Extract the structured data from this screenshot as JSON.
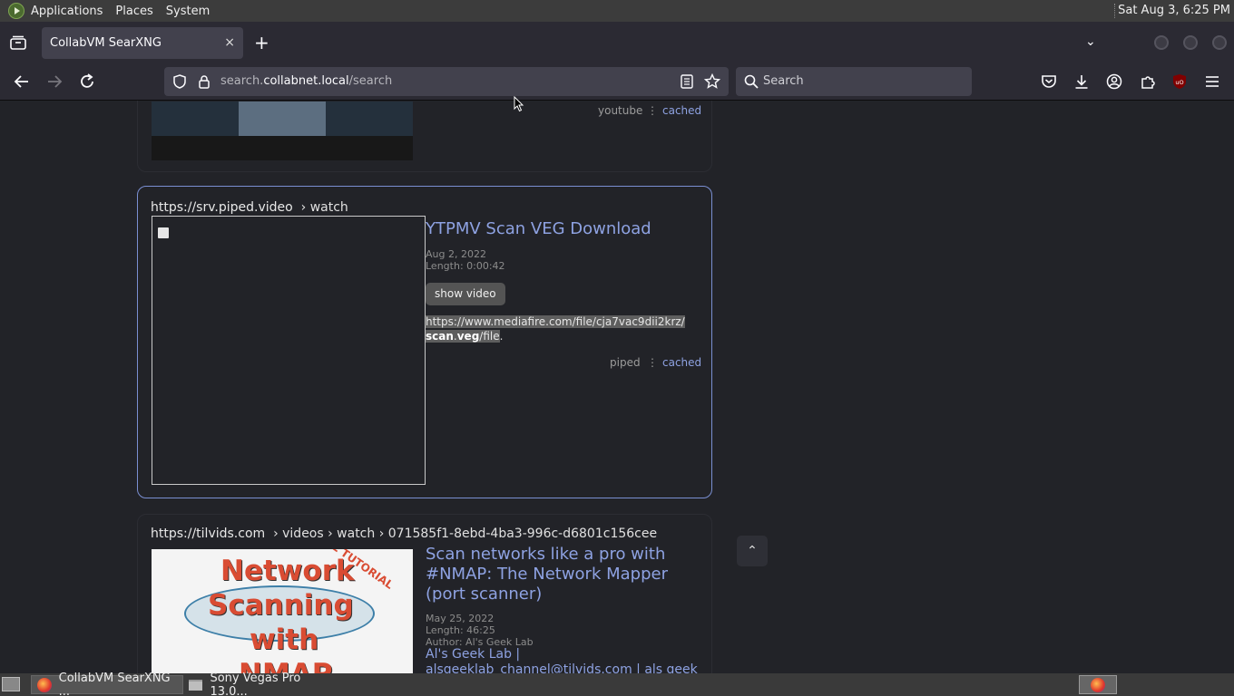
{
  "top_panel": {
    "menus": [
      "Applications",
      "Places",
      "System"
    ],
    "clock": "Sat Aug  3,  6:25 PM"
  },
  "browser": {
    "tab_title": "CollabVM SearXNG",
    "tab_close": "×",
    "new_tab": "+",
    "url_domain_prefix": "search.",
    "url_domain": "collabnet.local",
    "url_path": "/search",
    "search_placeholder": "Search"
  },
  "results": [
    {
      "engine": "youtube",
      "cached": "cached"
    },
    {
      "url_host": "https://srv.piped.video",
      "url_path": "› watch",
      "title": "YTPMV Scan VEG Download",
      "date": "Aug 2, 2022",
      "length": "Length: 0:00:42",
      "show_video": "show video",
      "content_line1": "https://www.mediafire.com/file/cja7vac9dii2krz/",
      "content_bold1": "scan",
      "content_dot": ".",
      "content_bold2": "veg",
      "content_tail": "/file",
      "content_end": ".",
      "engine": "piped",
      "cached": "cached"
    },
    {
      "url_host": "https://tilvids.com",
      "url_path": "› videos › watch › 071585f1-8ebd-4ba3-996c-d6801c156cee",
      "title": "Scan networks like a pro with #NMAP: The Network Mapper (port scanner)",
      "date": "May 25, 2022",
      "length": "Length: 46:25",
      "author": "Author: Al's Geek Lab",
      "link1": "Al's Geek Lab |",
      "link2": "alsgeeklab_channel@tilvids.com | als geek",
      "thumb_words": [
        "Network",
        "Scanning",
        "with",
        "NMAP"
      ],
      "thumb_tag": "FULL TUTORIAL"
    }
  ],
  "taskbar": {
    "items": [
      "CollabVM SearXNG ...",
      "Sony Vegas Pro 13.0..."
    ]
  },
  "colors": {
    "accent_link": "#8ea2e2",
    "highlight_border": "#7a8fd2",
    "page_bg": "#222328"
  }
}
